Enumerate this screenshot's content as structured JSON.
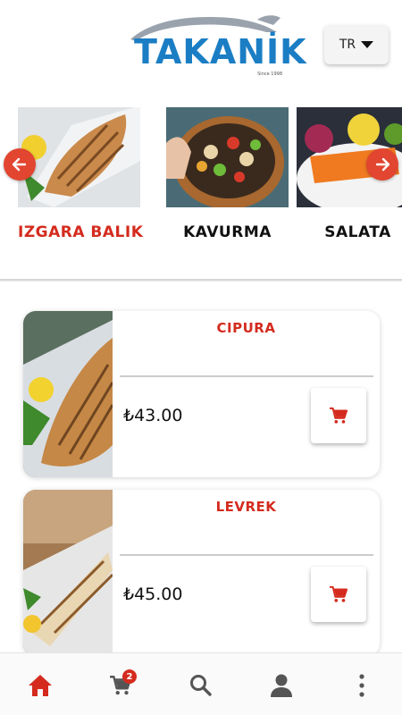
{
  "header": {
    "logo_text": "TAKANİK",
    "logo_tagline": "Since 1998",
    "language_label": "TR"
  },
  "categories": [
    {
      "label": "IZGARA BALIK",
      "active": true
    },
    {
      "label": "KAVURMA",
      "active": false
    },
    {
      "label": "SALATA",
      "active": false
    }
  ],
  "carousel": {
    "prev_icon": "arrow-left-icon",
    "next_icon": "arrow-right-icon"
  },
  "products": [
    {
      "name": "CIPURA",
      "price": "₺43.00"
    },
    {
      "name": "LEVREK",
      "price": "₺45.00"
    }
  ],
  "bottom_nav": {
    "items": [
      "home-icon",
      "cart-icon",
      "search-icon",
      "user-icon",
      "more-icon"
    ],
    "cart_badge": "2"
  },
  "colors": {
    "accent": "#d42b1e",
    "arrow_button": "#e24530",
    "logo_blue": "#1b7ec4"
  }
}
